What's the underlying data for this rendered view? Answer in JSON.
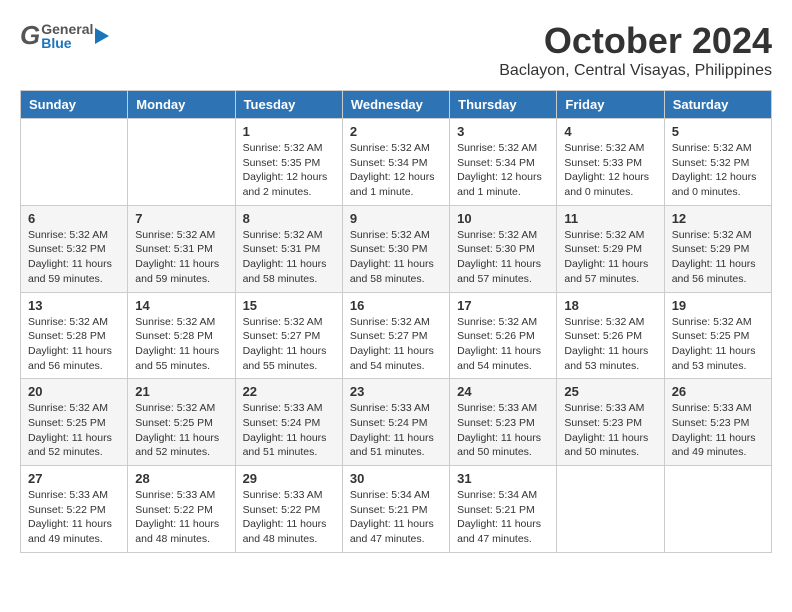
{
  "header": {
    "logo": {
      "general": "General",
      "blue": "Blue"
    },
    "month": "October 2024",
    "location": "Baclayon, Central Visayas, Philippines"
  },
  "days": [
    "Sunday",
    "Monday",
    "Tuesday",
    "Wednesday",
    "Thursday",
    "Friday",
    "Saturday"
  ],
  "weeks": [
    [
      {
        "day": "",
        "info": ""
      },
      {
        "day": "",
        "info": ""
      },
      {
        "day": "1",
        "info": "Sunrise: 5:32 AM\nSunset: 5:35 PM\nDaylight: 12 hours\nand 2 minutes."
      },
      {
        "day": "2",
        "info": "Sunrise: 5:32 AM\nSunset: 5:34 PM\nDaylight: 12 hours\nand 1 minute."
      },
      {
        "day": "3",
        "info": "Sunrise: 5:32 AM\nSunset: 5:34 PM\nDaylight: 12 hours\nand 1 minute."
      },
      {
        "day": "4",
        "info": "Sunrise: 5:32 AM\nSunset: 5:33 PM\nDaylight: 12 hours\nand 0 minutes."
      },
      {
        "day": "5",
        "info": "Sunrise: 5:32 AM\nSunset: 5:32 PM\nDaylight: 12 hours\nand 0 minutes."
      }
    ],
    [
      {
        "day": "6",
        "info": "Sunrise: 5:32 AM\nSunset: 5:32 PM\nDaylight: 11 hours\nand 59 minutes."
      },
      {
        "day": "7",
        "info": "Sunrise: 5:32 AM\nSunset: 5:31 PM\nDaylight: 11 hours\nand 59 minutes."
      },
      {
        "day": "8",
        "info": "Sunrise: 5:32 AM\nSunset: 5:31 PM\nDaylight: 11 hours\nand 58 minutes."
      },
      {
        "day": "9",
        "info": "Sunrise: 5:32 AM\nSunset: 5:30 PM\nDaylight: 11 hours\nand 58 minutes."
      },
      {
        "day": "10",
        "info": "Sunrise: 5:32 AM\nSunset: 5:30 PM\nDaylight: 11 hours\nand 57 minutes."
      },
      {
        "day": "11",
        "info": "Sunrise: 5:32 AM\nSunset: 5:29 PM\nDaylight: 11 hours\nand 57 minutes."
      },
      {
        "day": "12",
        "info": "Sunrise: 5:32 AM\nSunset: 5:29 PM\nDaylight: 11 hours\nand 56 minutes."
      }
    ],
    [
      {
        "day": "13",
        "info": "Sunrise: 5:32 AM\nSunset: 5:28 PM\nDaylight: 11 hours\nand 56 minutes."
      },
      {
        "day": "14",
        "info": "Sunrise: 5:32 AM\nSunset: 5:28 PM\nDaylight: 11 hours\nand 55 minutes."
      },
      {
        "day": "15",
        "info": "Sunrise: 5:32 AM\nSunset: 5:27 PM\nDaylight: 11 hours\nand 55 minutes."
      },
      {
        "day": "16",
        "info": "Sunrise: 5:32 AM\nSunset: 5:27 PM\nDaylight: 11 hours\nand 54 minutes."
      },
      {
        "day": "17",
        "info": "Sunrise: 5:32 AM\nSunset: 5:26 PM\nDaylight: 11 hours\nand 54 minutes."
      },
      {
        "day": "18",
        "info": "Sunrise: 5:32 AM\nSunset: 5:26 PM\nDaylight: 11 hours\nand 53 minutes."
      },
      {
        "day": "19",
        "info": "Sunrise: 5:32 AM\nSunset: 5:25 PM\nDaylight: 11 hours\nand 53 minutes."
      }
    ],
    [
      {
        "day": "20",
        "info": "Sunrise: 5:32 AM\nSunset: 5:25 PM\nDaylight: 11 hours\nand 52 minutes."
      },
      {
        "day": "21",
        "info": "Sunrise: 5:32 AM\nSunset: 5:25 PM\nDaylight: 11 hours\nand 52 minutes."
      },
      {
        "day": "22",
        "info": "Sunrise: 5:33 AM\nSunset: 5:24 PM\nDaylight: 11 hours\nand 51 minutes."
      },
      {
        "day": "23",
        "info": "Sunrise: 5:33 AM\nSunset: 5:24 PM\nDaylight: 11 hours\nand 51 minutes."
      },
      {
        "day": "24",
        "info": "Sunrise: 5:33 AM\nSunset: 5:23 PM\nDaylight: 11 hours\nand 50 minutes."
      },
      {
        "day": "25",
        "info": "Sunrise: 5:33 AM\nSunset: 5:23 PM\nDaylight: 11 hours\nand 50 minutes."
      },
      {
        "day": "26",
        "info": "Sunrise: 5:33 AM\nSunset: 5:23 PM\nDaylight: 11 hours\nand 49 minutes."
      }
    ],
    [
      {
        "day": "27",
        "info": "Sunrise: 5:33 AM\nSunset: 5:22 PM\nDaylight: 11 hours\nand 49 minutes."
      },
      {
        "day": "28",
        "info": "Sunrise: 5:33 AM\nSunset: 5:22 PM\nDaylight: 11 hours\nand 48 minutes."
      },
      {
        "day": "29",
        "info": "Sunrise: 5:33 AM\nSunset: 5:22 PM\nDaylight: 11 hours\nand 48 minutes."
      },
      {
        "day": "30",
        "info": "Sunrise: 5:34 AM\nSunset: 5:21 PM\nDaylight: 11 hours\nand 47 minutes."
      },
      {
        "day": "31",
        "info": "Sunrise: 5:34 AM\nSunset: 5:21 PM\nDaylight: 11 hours\nand 47 minutes."
      },
      {
        "day": "",
        "info": ""
      },
      {
        "day": "",
        "info": ""
      }
    ]
  ]
}
